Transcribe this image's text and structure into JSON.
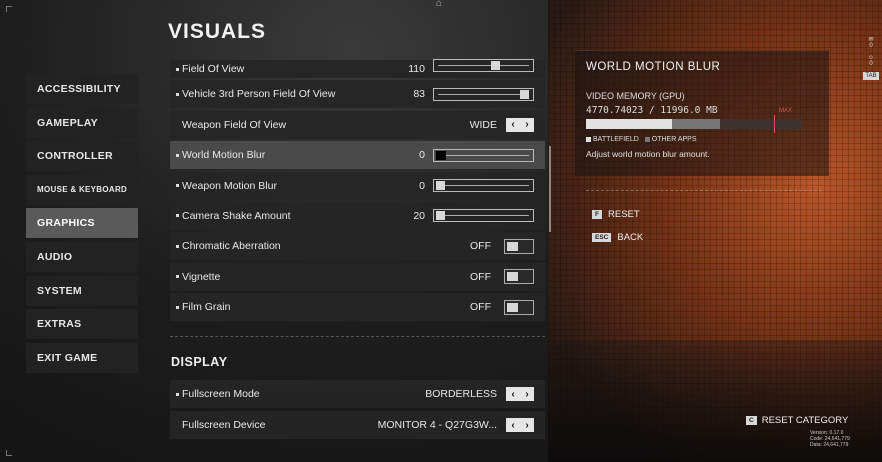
{
  "page_title": "VISUALS",
  "sidebar": {
    "items": [
      {
        "label": "ACCESSIBILITY",
        "active": false
      },
      {
        "label": "GAMEPLAY",
        "active": false
      },
      {
        "label": "CONTROLLER",
        "active": false
      },
      {
        "label": "MOUSE & KEYBOARD",
        "active": false
      },
      {
        "label": "GRAPHICS",
        "active": true
      },
      {
        "label": "AUDIO",
        "active": false
      },
      {
        "label": "SYSTEM",
        "active": false
      },
      {
        "label": "EXTRAS",
        "active": false
      },
      {
        "label": "EXIT GAME",
        "active": false
      }
    ]
  },
  "visuals": {
    "field_of_view": {
      "label": "Field Of View",
      "value": "110",
      "level": 0.66
    },
    "vehicle_fov": {
      "label": "Vehicle 3rd Person Field Of View",
      "value": "83",
      "level": 1.0
    },
    "weapon_fov": {
      "label": "Weapon Field Of View",
      "value": "WIDE"
    },
    "world_motion_blur": {
      "label": "World Motion Blur",
      "value": "0",
      "level": 0
    },
    "weapon_motion_blur": {
      "label": "Weapon Motion Blur",
      "value": "0",
      "level": 0
    },
    "camera_shake": {
      "label": "Camera Shake Amount",
      "value": "20",
      "level": 0
    },
    "chromatic_aberration": {
      "label": "Chromatic Aberration",
      "value": "OFF"
    },
    "vignette": {
      "label": "Vignette",
      "value": "OFF"
    },
    "film_grain": {
      "label": "Film Grain",
      "value": "OFF"
    }
  },
  "display": {
    "section_title": "DISPLAY",
    "fullscreen_mode": {
      "label": "Fullscreen Mode",
      "value": "BORDERLESS"
    },
    "fullscreen_device": {
      "label": "Fullscreen Device",
      "value": "MONITOR 4 - Q27G3W..."
    }
  },
  "info_panel": {
    "title": "WORLD MOTION BLUR",
    "memory_label": "VIDEO MEMORY (GPU)",
    "memory_value": "4770.74023 / 11996.0 MB",
    "memory_used_fraction": 0.4,
    "memory_other_fraction": 0.22,
    "max_label": "MAX",
    "legend_battlefield": "BATTLEFIELD",
    "legend_other_apps": "OTHER APPS",
    "description": "Adjust world motion blur amount."
  },
  "actions": {
    "reset": {
      "key": "F",
      "label": "RESET"
    },
    "back": {
      "key": "ESC",
      "label": "BACK"
    },
    "reset_category": {
      "key": "C",
      "label": "RESET CATEGORY"
    }
  },
  "side_icons": {
    "tab_key": "TAB",
    "count_a": "0",
    "count_b": "0"
  },
  "version_info": {
    "version": "Version: 0.17.0",
    "code": "Code: 24,641,779",
    "data": "Data: 24,641,779"
  },
  "colors": {
    "accent_orange": "#c45a2a",
    "max_red": "#e05050",
    "active_row": "#4a4a4a"
  }
}
